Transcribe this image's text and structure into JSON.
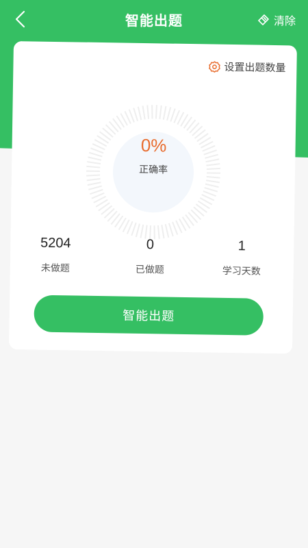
{
  "nav": {
    "title": "智能出题",
    "clear_label": "清除"
  },
  "card": {
    "settings_label": "设置出题数量",
    "accuracy_value": "0%",
    "accuracy_label": "正确率",
    "stats": [
      {
        "value": "5204",
        "label": "未做题"
      },
      {
        "value": "0",
        "label": "已做题"
      },
      {
        "value": "1",
        "label": "学习天数"
      }
    ],
    "cta_label": "智能出题"
  },
  "colors": {
    "brand": "#35bf63",
    "accent": "#e86c2e"
  }
}
